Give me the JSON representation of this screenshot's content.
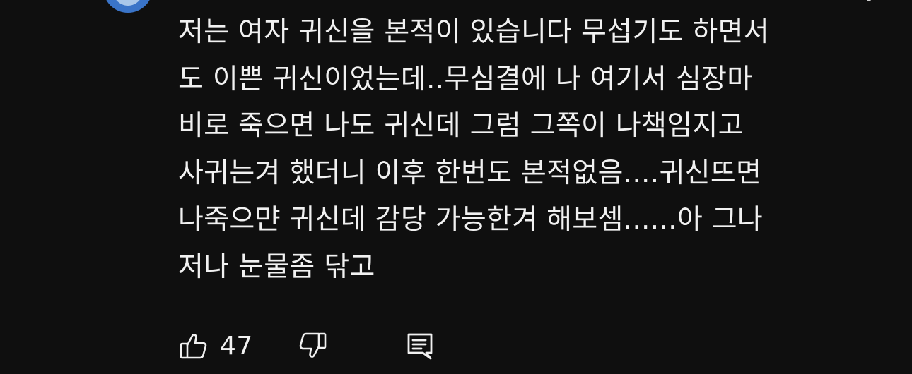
{
  "comment": {
    "lines": [
      "저는 여자 귀신을 본적이 있습니다 무섭기도 하면서",
      "도 이쁜 귀신이었는데..무심결에 나 여기서 심장마",
      "비로 죽으면 나도 귀신데 그럼 그쪽이 나책임지고",
      "사귀는겨 했더니 이후 한번도 본적없음....귀신뜨면",
      "나죽으먄 귀신데 감당 가능한겨 해보셈......아 그나",
      "저나 눈물좀 닦고"
    ]
  },
  "actions": {
    "like_count": "47",
    "like_icon": "thumbs-up-icon",
    "dislike_icon": "thumbs-down-icon",
    "reply_icon": "comment-reply-icon"
  },
  "colors": {
    "background": "#0f0f0f",
    "text": "#f1f1f1",
    "avatar": "#3a74c8"
  }
}
